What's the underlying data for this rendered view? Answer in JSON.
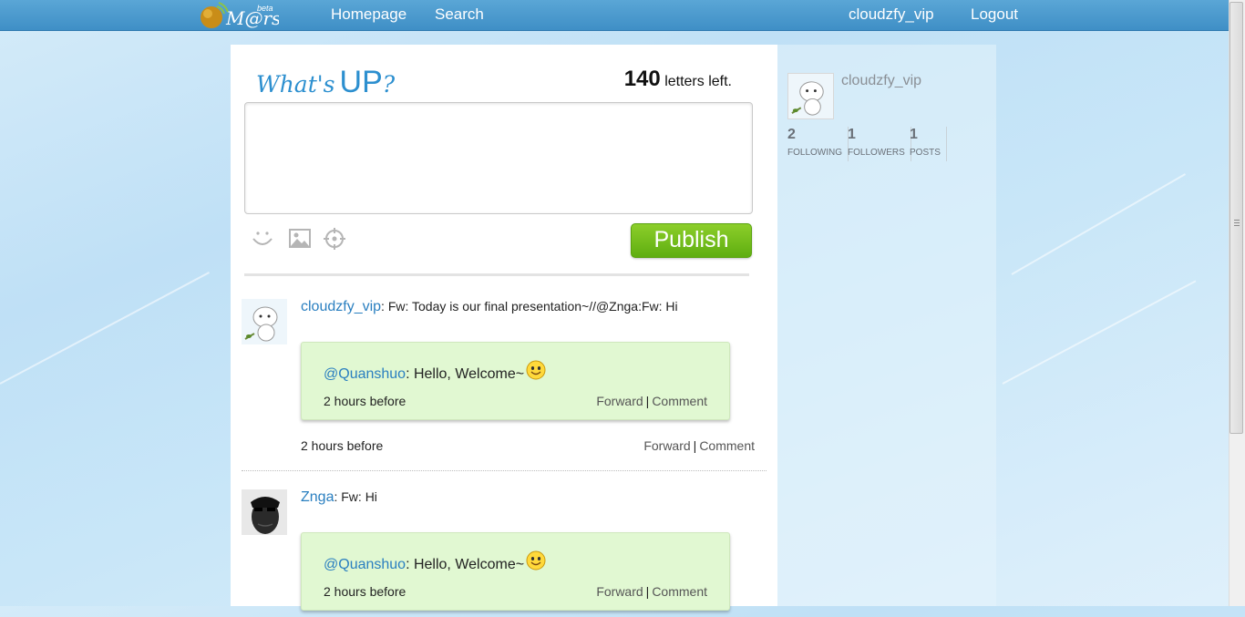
{
  "nav": {
    "logo_text": "M@rs",
    "logo_badge": "beta",
    "homepage": "Homepage",
    "search": "Search",
    "username": "cloudzfy_vip",
    "logout": "Logout"
  },
  "composer": {
    "title_part1": "What's",
    "title_part2": "UP",
    "title_part3": "?",
    "letters_left": "140",
    "letters_left_label": "letters left.",
    "textarea_value": "",
    "publish_label": "Publish",
    "icons": [
      "smiley-icon",
      "image-icon",
      "location-crosshair-icon"
    ]
  },
  "feed": [
    {
      "user": "cloudzfy_vip",
      "text": "Fw: Today is our final presentation~//@Znga:Fw: Hi",
      "forwarded": {
        "mention": "@Quanshuo",
        "text": ": Hello, Welcome~",
        "time": "2 hours before",
        "forward_label": "Forward",
        "comment_label": "Comment"
      },
      "time": "2 hours before",
      "forward_label": "Forward",
      "comment_label": "Comment"
    },
    {
      "user": "Znga",
      "text": "Fw: Hi",
      "forwarded": {
        "mention": "@Quanshuo",
        "text": ": Hello, Welcome~",
        "time": "2 hours before",
        "forward_label": "Forward",
        "comment_label": "Comment"
      }
    }
  ],
  "profile": {
    "name": "cloudzfy_vip",
    "stats": [
      {
        "value": "2",
        "label": "FOLLOWING"
      },
      {
        "value": "1",
        "label": "FOLLOWERS"
      },
      {
        "value": "1",
        "label": "POSTS"
      }
    ]
  },
  "colors": {
    "accent_blue": "#2a7fc0",
    "publish_green": "#6ab81a",
    "forward_box_bg": "#e1f8d2",
    "topbar": "#4a9ace"
  }
}
